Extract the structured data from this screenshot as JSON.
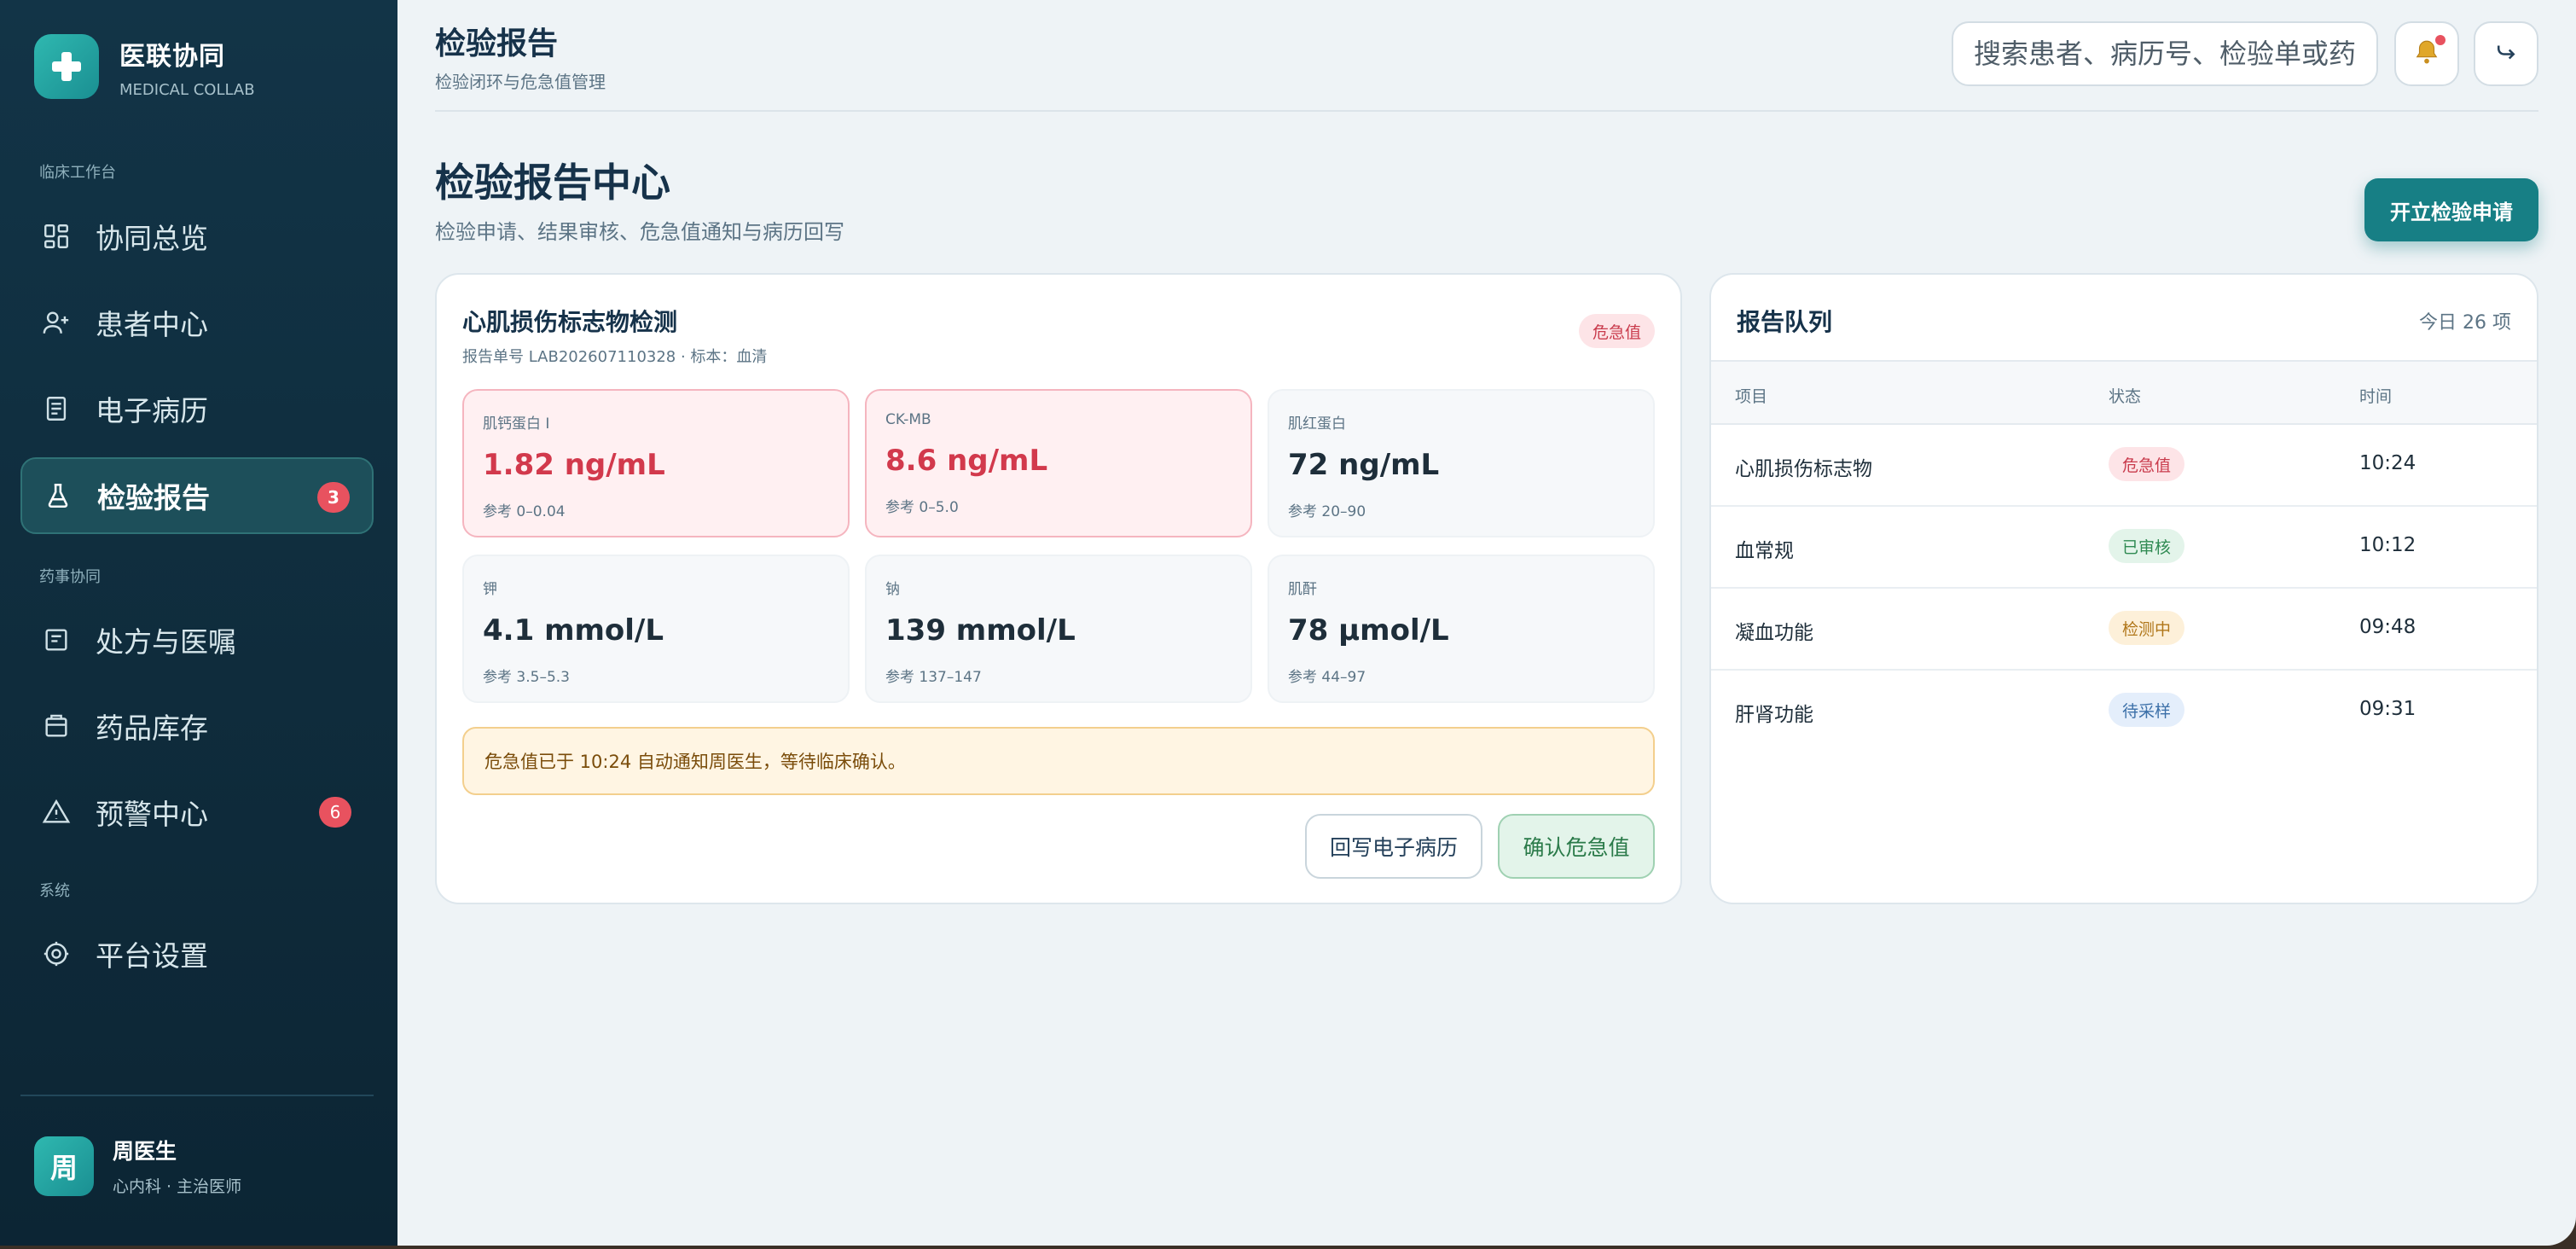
{
  "brand": {
    "title": "医联协同",
    "subtitle": "MEDICAL COLLAB"
  },
  "sidebar": {
    "sections": [
      "临床工作台",
      "药事协同",
      "系统"
    ],
    "items": [
      {
        "label": "协同总览",
        "icon": "dashboard-icon"
      },
      {
        "label": "患者中心",
        "icon": "user-plus-icon"
      },
      {
        "label": "电子病历",
        "icon": "document-icon"
      },
      {
        "label": "检验报告",
        "icon": "flask-icon",
        "badge": "3",
        "active": true
      },
      {
        "label": "处方与医嘱",
        "icon": "prescription-icon"
      },
      {
        "label": "药品库存",
        "icon": "box-icon"
      },
      {
        "label": "预警中心",
        "icon": "warning-icon",
        "badge": "6"
      },
      {
        "label": "平台设置",
        "icon": "gear-icon"
      }
    ]
  },
  "user": {
    "initial": "周",
    "name": "周医生",
    "role": "心内科 · 主治医师"
  },
  "header": {
    "title": "检验报告",
    "subtitle": "检验闭环与危急值管理",
    "search_placeholder": "搜索患者、病历号、检验单或药品",
    "icons": [
      "bell-icon",
      "logout-icon"
    ]
  },
  "page": {
    "title": "检验报告中心",
    "subtitle": "检验申请、结果审核、危急值通知与病历回写",
    "primary_action": "开立检验申请"
  },
  "report": {
    "title": "心肌损伤标志物检测",
    "meta": "报告单号 LAB202607110328 · 标本：血清",
    "status": "危急值",
    "results": [
      {
        "label": "肌钙蛋白 I",
        "value": "1.82 ng/mL",
        "ref": "参考 0–0.04",
        "critical": true
      },
      {
        "label": "CK-MB",
        "value": "8.6 ng/mL",
        "ref": "参考 0–5.0",
        "critical": true
      },
      {
        "label": "肌红蛋白",
        "value": "72 ng/mL",
        "ref": "参考 20–90",
        "critical": false
      },
      {
        "label": "钾",
        "value": "4.1 mmol/L",
        "ref": "参考 3.5–5.3",
        "critical": false
      },
      {
        "label": "钠",
        "value": "139 mmol/L",
        "ref": "参考 137–147",
        "critical": false
      },
      {
        "label": "肌酐",
        "value": "78 μmol/L",
        "ref": "参考 44–97",
        "critical": false
      }
    ],
    "alert": "危急值已于 10:24 自动通知周医生，等待临床确认。",
    "actions": {
      "writeback": "回写电子病历",
      "confirm": "确认危急值"
    }
  },
  "queue": {
    "title": "报告队列",
    "count": "今日 26 项",
    "columns": [
      "项目",
      "状态",
      "时间"
    ],
    "rows": [
      {
        "item": "心肌损伤标志物",
        "status": "危急值",
        "time": "10:24",
        "tone": "danger"
      },
      {
        "item": "血常规",
        "status": "已审核",
        "time": "10:12",
        "tone": "ok"
      },
      {
        "item": "凝血功能",
        "status": "检测中",
        "time": "09:48",
        "tone": "warn"
      },
      {
        "item": "肝肾功能",
        "status": "待采样",
        "time": "09:31",
        "tone": "info"
      }
    ]
  },
  "colors": {
    "accent": "#177f85",
    "danger": "#d2394c",
    "sidebar": "#123447"
  }
}
